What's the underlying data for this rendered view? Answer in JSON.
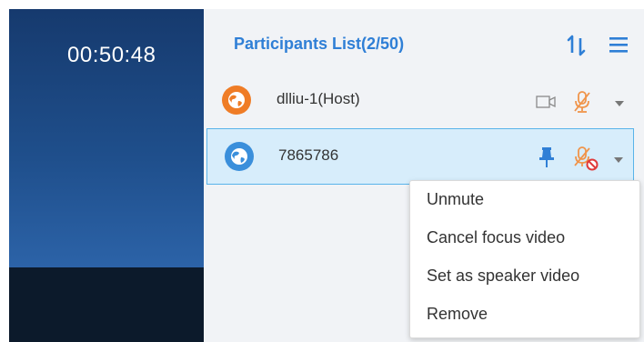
{
  "video": {
    "timer": "00:50:48"
  },
  "panel": {
    "title": "Participants List(2/50)",
    "sort_icon": "sort-icon",
    "menu_icon": "menu-icon"
  },
  "participants": [
    {
      "name": "dlliu-1(Host)",
      "avatar_color": "#ef7c26",
      "controls": [
        "camera-icon",
        "mic-muted-icon",
        "chevron-down-icon"
      ]
    },
    {
      "name": "7865786",
      "avatar_color": "#3a8fdb",
      "selected": true,
      "controls": [
        "pin-icon",
        "mic-blocked-icon",
        "chevron-down-icon"
      ]
    }
  ],
  "context_menu": {
    "items": [
      {
        "label": "Unmute"
      },
      {
        "label": "Cancel focus video"
      },
      {
        "label": "Set as speaker video"
      },
      {
        "label": "Remove"
      }
    ]
  },
  "colors": {
    "accent": "#2f7fd6",
    "selected_bg": "#d7edfb",
    "selected_border": "#59b4ea",
    "muted_orange": "#f0944a",
    "blocked_red": "#e03a3a"
  }
}
